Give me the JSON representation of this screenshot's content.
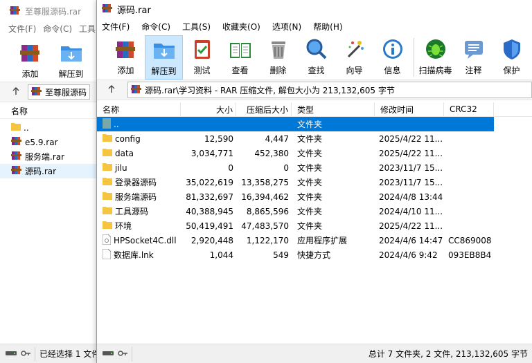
{
  "back_window": {
    "title": "至尊服源码.rar",
    "menu": [
      "文件(F)",
      "命令(C)",
      "工具"
    ],
    "toolbar": [
      {
        "label": "添加",
        "icon": "rar-books-icon"
      },
      {
        "label": "解压到",
        "icon": "extract-folder-icon"
      }
    ],
    "address": "至尊服源码",
    "column_name": "名称",
    "files": [
      {
        "name": "..",
        "icon": "folder-icon"
      },
      {
        "name": "e5.9.rar",
        "icon": "rar-icon"
      },
      {
        "name": "服务端.rar",
        "icon": "rar-icon"
      },
      {
        "name": "源码.rar",
        "icon": "rar-icon"
      }
    ],
    "left_gutter": [
      "8",
      "3"
    ],
    "status": "已经选择 1 文件"
  },
  "front_window": {
    "title": "源码.rar",
    "menu": [
      "文件(F)",
      "命令(C)",
      "工具(S)",
      "收藏夹(O)",
      "选项(N)",
      "帮助(H)"
    ],
    "toolbar": [
      {
        "label": "添加",
        "icon": "add-books-icon"
      },
      {
        "label": "解压到",
        "icon": "extract-folder-icon",
        "active": true
      },
      {
        "label": "测试",
        "icon": "test-clipboard-icon"
      },
      {
        "label": "查看",
        "icon": "view-book-icon"
      },
      {
        "label": "删除",
        "icon": "trash-icon"
      },
      {
        "label": "查找",
        "icon": "magnifier-icon"
      },
      {
        "label": "向导",
        "icon": "wand-icon"
      },
      {
        "label": "信息",
        "icon": "info-icon"
      },
      {
        "label": "扫描病毒",
        "icon": "bug-icon"
      },
      {
        "label": "注释",
        "icon": "comment-icon"
      },
      {
        "label": "保护",
        "icon": "shield-icon"
      }
    ],
    "address": "源码.rar\\学习资料 - RAR 压缩文件, 解包大小为 213,132,605 字节",
    "columns": {
      "name": "名称",
      "size": "大小",
      "packed": "压缩后大小",
      "type": "类型",
      "modified": "修改时间",
      "crc": "CRC32"
    },
    "rows": [
      {
        "name": "..",
        "size": "",
        "packed": "",
        "type": "文件夹",
        "modified": "",
        "crc": "",
        "kind": "up",
        "selected": true
      },
      {
        "name": "config",
        "size": "12,590",
        "packed": "4,447",
        "type": "文件夹",
        "modified": "2025/4/22 11...",
        "crc": "",
        "kind": "folder"
      },
      {
        "name": "data",
        "size": "3,034,771",
        "packed": "452,380",
        "type": "文件夹",
        "modified": "2025/4/22 11...",
        "crc": "",
        "kind": "folder"
      },
      {
        "name": "jilu",
        "size": "0",
        "packed": "0",
        "type": "文件夹",
        "modified": "2023/11/7 15...",
        "crc": "",
        "kind": "folder"
      },
      {
        "name": "登录器源码",
        "size": "35,022,619",
        "packed": "13,358,275",
        "type": "文件夹",
        "modified": "2023/11/7 15...",
        "crc": "",
        "kind": "folder"
      },
      {
        "name": "服务端源码",
        "size": "81,332,697",
        "packed": "16,394,462",
        "type": "文件夹",
        "modified": "2024/4/8 13:44",
        "crc": "",
        "kind": "folder"
      },
      {
        "name": "工具源码",
        "size": "40,388,945",
        "packed": "8,865,596",
        "type": "文件夹",
        "modified": "2024/4/10 11...",
        "crc": "",
        "kind": "folder"
      },
      {
        "name": "环境",
        "size": "50,419,491",
        "packed": "47,483,570",
        "type": "文件夹",
        "modified": "2025/4/22 11...",
        "crc": "",
        "kind": "folder"
      },
      {
        "name": "HPSocket4C.dll",
        "size": "2,920,448",
        "packed": "1,122,170",
        "type": "应用程序扩展",
        "modified": "2024/4/6 14:47",
        "crc": "CC869008",
        "kind": "dll"
      },
      {
        "name": "数据库.lnk",
        "size": "1,044",
        "packed": "549",
        "type": "快捷方式",
        "modified": "2024/4/6 9:42",
        "crc": "093EB8B4",
        "kind": "lnk"
      }
    ],
    "status": "总计 7 文件夹, 2 文件, 213,132,605 字节"
  },
  "colors": {
    "selection": "#0078d7",
    "active_button": "#cce8ff",
    "folder": "#f5c542"
  }
}
